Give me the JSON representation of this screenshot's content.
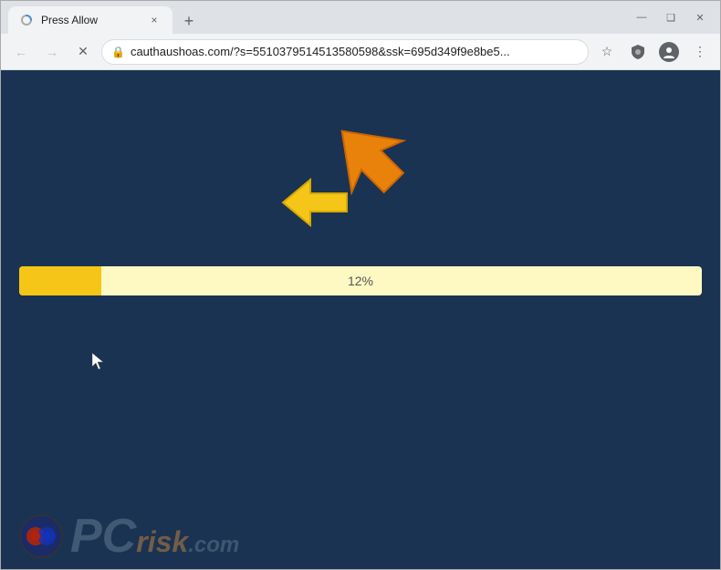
{
  "browser": {
    "tab": {
      "title": "Press Allow",
      "close_label": "×"
    },
    "new_tab_label": "+",
    "window_controls": {
      "minimize": "—",
      "maximize": "❑",
      "close": "✕"
    },
    "toolbar": {
      "back_label": "←",
      "forward_label": "→",
      "reload_label": "✕",
      "address": "cauthaushoas.com/?s=5510379514513580598&ssk=695d349f9e8be5...",
      "star_label": "☆",
      "menu_label": "⋮"
    }
  },
  "page": {
    "progress_percent": 12,
    "progress_label": "12%",
    "progress_bar_width_pct": 12,
    "background_color": "#1a3352",
    "progress_bg": "#fef9c3",
    "progress_fill": "#f5c518"
  },
  "watermark": {
    "text_pc": "PC",
    "text_risk": "risk",
    "text_dotcom": ".com"
  },
  "icons": {
    "lock": "🔒",
    "shield": "🛡",
    "arrow_orange_unicode": "↗",
    "arrow_yellow_unicode": "←"
  }
}
